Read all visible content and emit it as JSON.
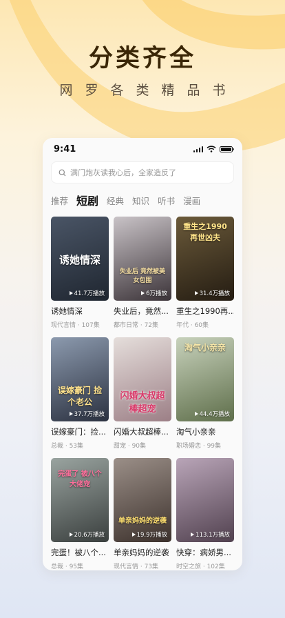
{
  "promo": {
    "title": "分类齐全",
    "subtitle": "网罗各类精品书"
  },
  "status_bar": {
    "time": "9:41"
  },
  "search": {
    "placeholder": "满门炮灰读我心后，全家造反了"
  },
  "tabs": [
    {
      "label": "推荐",
      "active": false
    },
    {
      "label": "短剧",
      "active": true
    },
    {
      "label": "经典",
      "active": false
    },
    {
      "label": "知识",
      "active": false
    },
    {
      "label": "听书",
      "active": false
    },
    {
      "label": "漫画",
      "active": false
    }
  ],
  "items": [
    {
      "title": "诱她情深",
      "meta": "现代言情 · 107集",
      "plays": "41.7万播放",
      "cover_text": "诱她情深",
      "colors": [
        "#4a5566",
        "#1f2630"
      ]
    },
    {
      "title": "失业后，竟然...",
      "meta": "都市日常 · 72集",
      "plays": "6万播放",
      "cover_text": "失业后 竟然被美女包围",
      "colors": [
        "#c9c3c7",
        "#3b3338"
      ]
    },
    {
      "title": "重生之1990再...",
      "meta": "年代 · 60集",
      "plays": "31.4万播放",
      "cover_text": "重生之1990再世凶夫",
      "colors": [
        "#6b5a3a",
        "#241c12"
      ]
    },
    {
      "title": "误嫁豪门：捡...",
      "meta": "总裁 · 53集",
      "plays": "37.7万播放",
      "cover_text": "误嫁豪门 捡个老公",
      "colors": [
        "#8c9aae",
        "#2b3140"
      ]
    },
    {
      "title": "闪婚大叔超棒...",
      "meta": "甜宠 · 90集",
      "plays": "",
      "cover_text": "闪婚大叔超棒超宠",
      "colors": [
        "#e5dedb",
        "#9c7f86"
      ]
    },
    {
      "title": "淘气小亲亲",
      "meta": "职场婚恋 · 99集",
      "plays": "44.4万播放",
      "cover_text": "淘气小亲亲",
      "colors": [
        "#c8d2bc",
        "#5e6e4a"
      ]
    },
    {
      "title": "完蛋！被八个...",
      "meta": "总裁 · 95集",
      "plays": "20.6万播放",
      "cover_text": "完蛋了 被八个大佬宠",
      "colors": [
        "#9aa4a0",
        "#3a3f3e"
      ]
    },
    {
      "title": "单亲妈妈的逆袭",
      "meta": "现代言情 · 73集",
      "plays": "19.9万播放",
      "cover_text": "单亲妈妈的逆袭",
      "colors": [
        "#9b8f88",
        "#3c312c"
      ]
    },
    {
      "title": "快穿：病娇男...",
      "meta": "时空之旅 · 102集",
      "plays": "113.1万播放",
      "cover_text": "",
      "colors": [
        "#b9a5b8",
        "#51414f"
      ]
    }
  ],
  "icons": [
    "search-icon",
    "signal-icon",
    "wifi-icon",
    "battery-icon",
    "play-icon"
  ]
}
